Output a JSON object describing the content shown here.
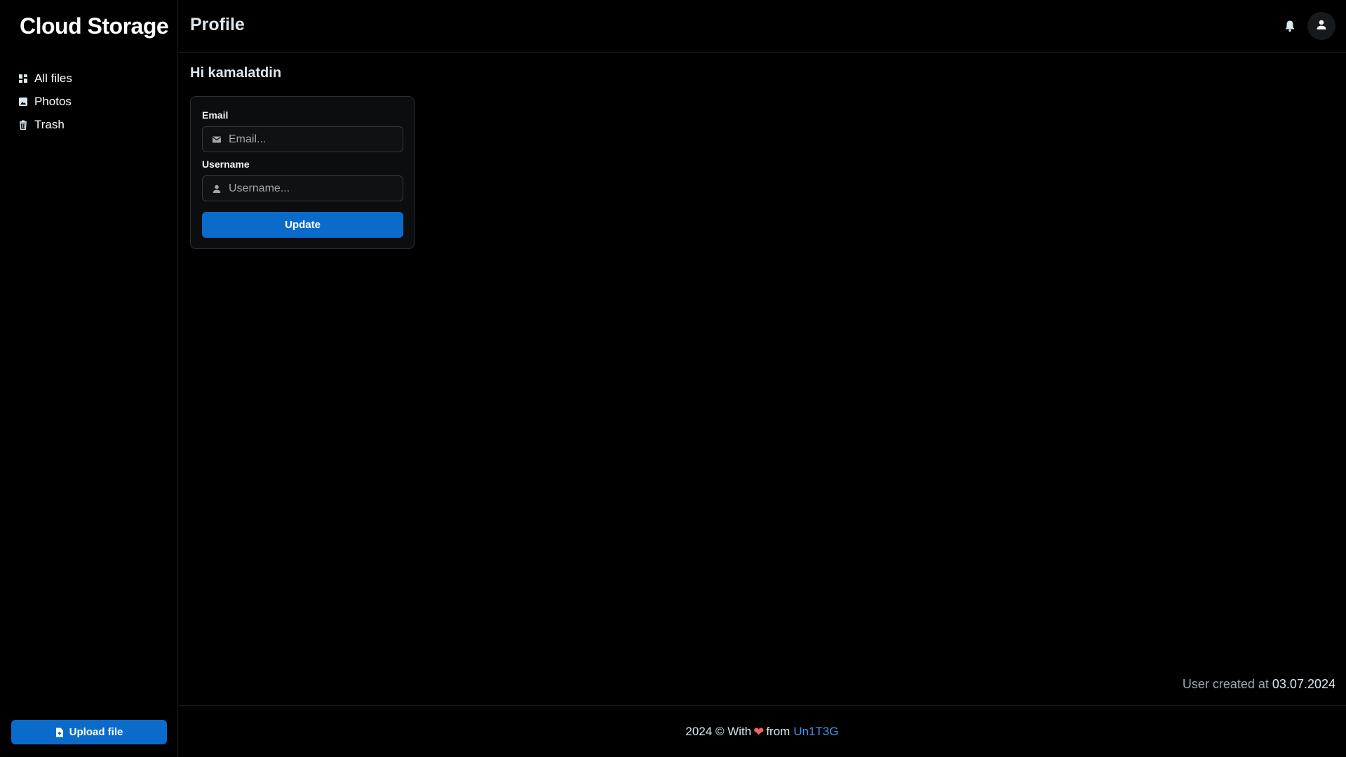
{
  "sidebar": {
    "brand": "Cloud Storage",
    "items": [
      {
        "label": "All files",
        "icon": "dashboard-icon"
      },
      {
        "label": "Photos",
        "icon": "image-icon"
      },
      {
        "label": "Trash",
        "icon": "trash-icon"
      }
    ],
    "upload_label": "Upload file"
  },
  "header": {
    "title": "Profile"
  },
  "profile": {
    "greeting": "Hi kamalatdin",
    "email_label": "Email",
    "email_placeholder": "Email...",
    "email_value": "",
    "username_label": "Username",
    "username_placeholder": "Username...",
    "username_value": "",
    "update_label": "Update",
    "created_prefix": "User created at",
    "created_date": "03.07.2024"
  },
  "footer": {
    "text_before": "2024 © With",
    "heart": "❤",
    "text_after": "from",
    "author": "Un1T3G"
  },
  "colors": {
    "accent": "#0b6bcb",
    "link": "#4393e4",
    "heart": "#f2645f",
    "background": "#000000"
  }
}
